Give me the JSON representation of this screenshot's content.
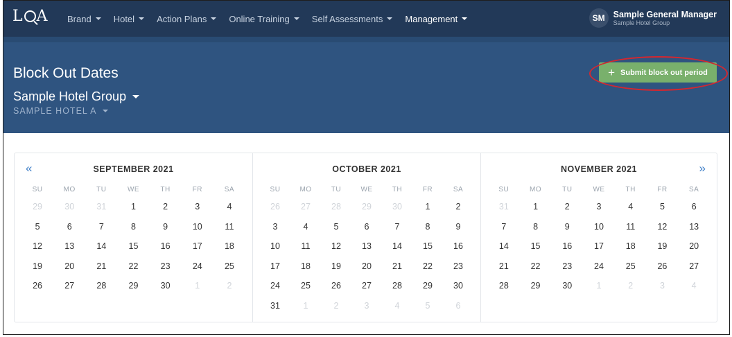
{
  "nav": {
    "logo": {
      "letter_l": "L",
      "letter_a": "A"
    },
    "menu": [
      {
        "label": "Brand",
        "active": false
      },
      {
        "label": "Hotel",
        "active": false
      },
      {
        "label": "Action Plans",
        "active": false
      },
      {
        "label": "Online Training",
        "active": false
      },
      {
        "label": "Self Assessments",
        "active": false
      },
      {
        "label": "Management",
        "active": true
      }
    ],
    "user": {
      "initials": "SM",
      "name": "Sample General Manager",
      "org": "Sample Hotel Group"
    }
  },
  "header": {
    "title": "Block Out Dates",
    "group": "Sample Hotel Group",
    "hotel": "SAMPLE HOTEL A",
    "submit_label": "Submit block out period",
    "submit_icon": "plus-icon"
  },
  "colors": {
    "nav_bg": "#223958",
    "band_bg": "#2f5480",
    "submit_bg": "#79b06c",
    "highlight": "#d4272f",
    "arrow": "#3f7fc8"
  },
  "calendar": {
    "prev_arrow": "«",
    "next_arrow": "»",
    "weekdays": [
      "SU",
      "MO",
      "TU",
      "WE",
      "TH",
      "FR",
      "SA"
    ],
    "months": [
      {
        "title": "SEPTEMBER 2021",
        "days": [
          {
            "d": "29",
            "o": true
          },
          {
            "d": "30",
            "o": true
          },
          {
            "d": "31",
            "o": true
          },
          {
            "d": "1"
          },
          {
            "d": "2"
          },
          {
            "d": "3"
          },
          {
            "d": "4"
          },
          {
            "d": "5"
          },
          {
            "d": "6"
          },
          {
            "d": "7"
          },
          {
            "d": "8"
          },
          {
            "d": "9"
          },
          {
            "d": "10"
          },
          {
            "d": "11"
          },
          {
            "d": "12"
          },
          {
            "d": "13"
          },
          {
            "d": "14"
          },
          {
            "d": "15"
          },
          {
            "d": "16"
          },
          {
            "d": "17"
          },
          {
            "d": "18"
          },
          {
            "d": "19"
          },
          {
            "d": "20"
          },
          {
            "d": "21"
          },
          {
            "d": "22"
          },
          {
            "d": "23"
          },
          {
            "d": "24"
          },
          {
            "d": "25"
          },
          {
            "d": "26"
          },
          {
            "d": "27"
          },
          {
            "d": "28"
          },
          {
            "d": "29"
          },
          {
            "d": "30"
          },
          {
            "d": "1",
            "o": true
          },
          {
            "d": "2",
            "o": true
          }
        ]
      },
      {
        "title": "OCTOBER 2021",
        "days": [
          {
            "d": "26",
            "o": true
          },
          {
            "d": "27",
            "o": true
          },
          {
            "d": "28",
            "o": true
          },
          {
            "d": "29",
            "o": true
          },
          {
            "d": "30",
            "o": true
          },
          {
            "d": "1"
          },
          {
            "d": "2"
          },
          {
            "d": "3"
          },
          {
            "d": "4"
          },
          {
            "d": "5"
          },
          {
            "d": "6"
          },
          {
            "d": "7"
          },
          {
            "d": "8"
          },
          {
            "d": "9"
          },
          {
            "d": "10"
          },
          {
            "d": "11"
          },
          {
            "d": "12"
          },
          {
            "d": "13"
          },
          {
            "d": "14"
          },
          {
            "d": "15"
          },
          {
            "d": "16"
          },
          {
            "d": "17"
          },
          {
            "d": "18"
          },
          {
            "d": "19"
          },
          {
            "d": "20"
          },
          {
            "d": "21"
          },
          {
            "d": "22"
          },
          {
            "d": "23"
          },
          {
            "d": "24"
          },
          {
            "d": "25"
          },
          {
            "d": "26"
          },
          {
            "d": "27"
          },
          {
            "d": "28"
          },
          {
            "d": "29"
          },
          {
            "d": "30"
          },
          {
            "d": "31"
          },
          {
            "d": "1",
            "o": true
          },
          {
            "d": "2",
            "o": true
          },
          {
            "d": "3",
            "o": true
          },
          {
            "d": "4",
            "o": true
          },
          {
            "d": "5",
            "o": true
          },
          {
            "d": "6",
            "o": true
          }
        ]
      },
      {
        "title": "NOVEMBER 2021",
        "days": [
          {
            "d": "31",
            "o": true
          },
          {
            "d": "1"
          },
          {
            "d": "2"
          },
          {
            "d": "3"
          },
          {
            "d": "4"
          },
          {
            "d": "5"
          },
          {
            "d": "6"
          },
          {
            "d": "7"
          },
          {
            "d": "8"
          },
          {
            "d": "9"
          },
          {
            "d": "10"
          },
          {
            "d": "11"
          },
          {
            "d": "12"
          },
          {
            "d": "13"
          },
          {
            "d": "14"
          },
          {
            "d": "15"
          },
          {
            "d": "16"
          },
          {
            "d": "17"
          },
          {
            "d": "18"
          },
          {
            "d": "19"
          },
          {
            "d": "20"
          },
          {
            "d": "21"
          },
          {
            "d": "22"
          },
          {
            "d": "23"
          },
          {
            "d": "24"
          },
          {
            "d": "25"
          },
          {
            "d": "26"
          },
          {
            "d": "27"
          },
          {
            "d": "28"
          },
          {
            "d": "29"
          },
          {
            "d": "30"
          },
          {
            "d": "1",
            "o": true
          },
          {
            "d": "2",
            "o": true
          },
          {
            "d": "3",
            "o": true
          },
          {
            "d": "4",
            "o": true
          }
        ]
      }
    ]
  }
}
